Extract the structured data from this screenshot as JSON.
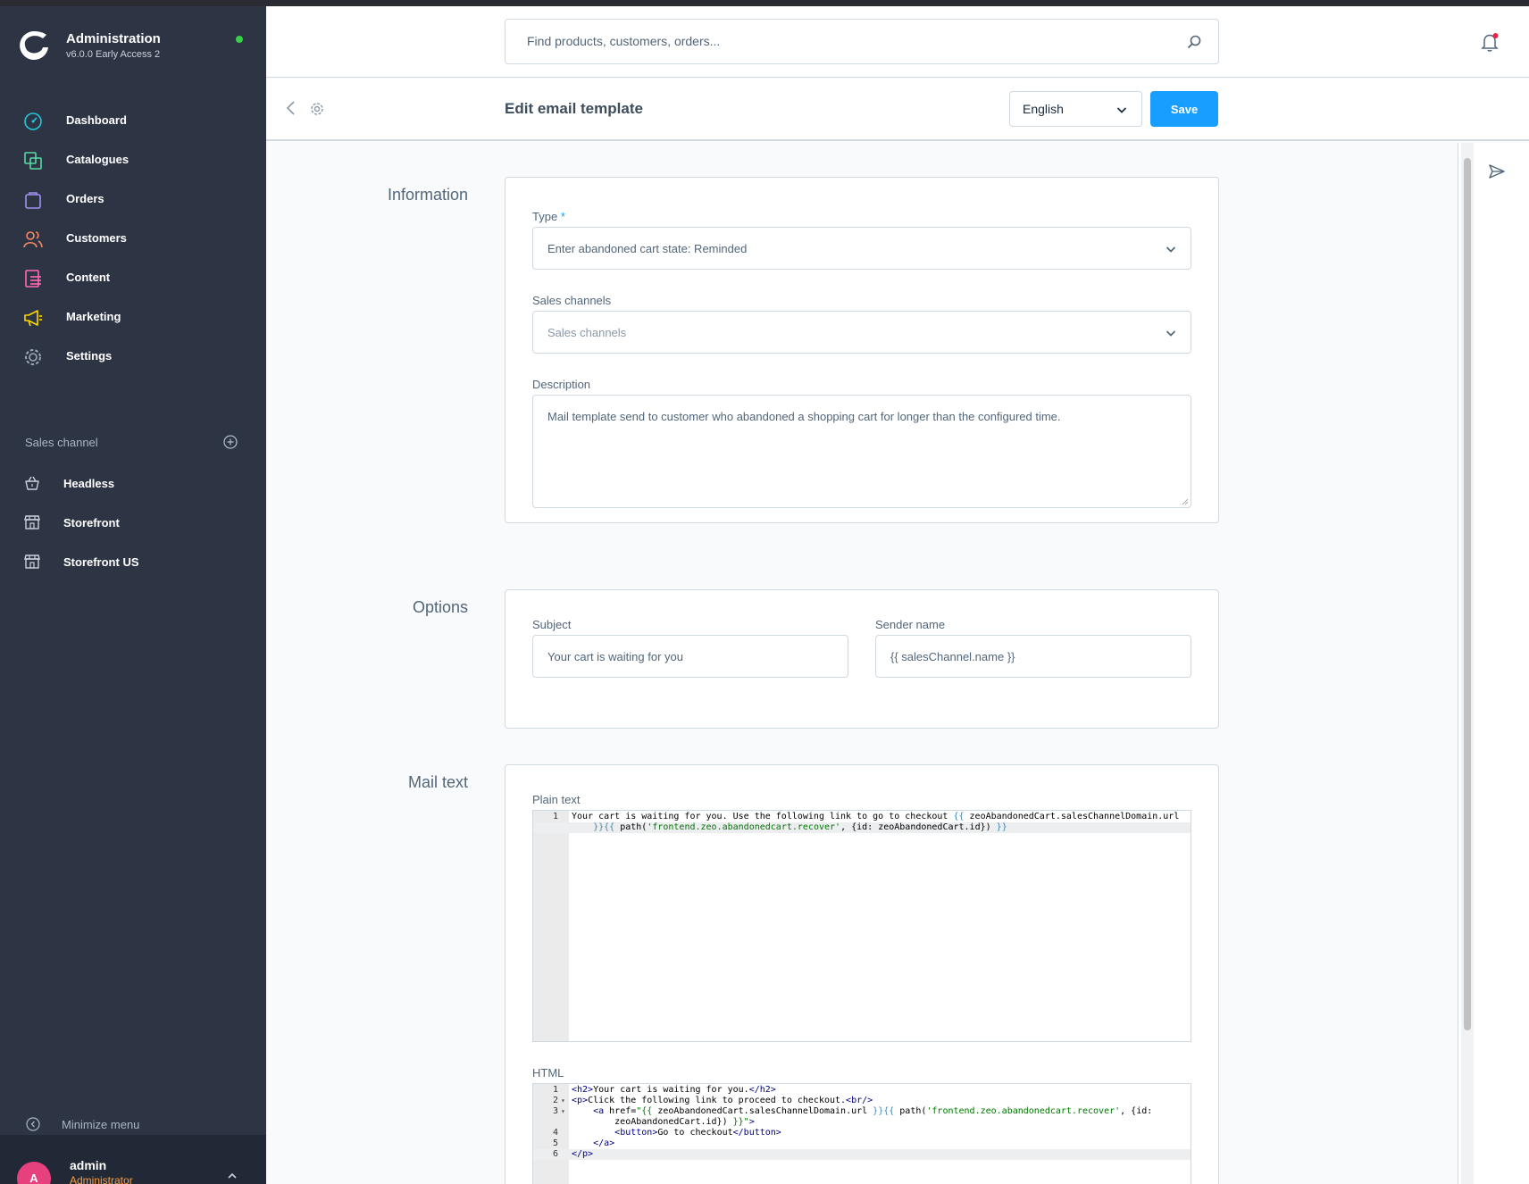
{
  "app": {
    "title": "Administration",
    "version": "v6.0.0 Early Access 2",
    "status_color": "#37d046",
    "accent_color": "#189eff"
  },
  "sidebar": {
    "items": [
      {
        "label": "Dashboard",
        "icon": "dashboard-icon"
      },
      {
        "label": "Catalogues",
        "icon": "catalogues-icon"
      },
      {
        "label": "Orders",
        "icon": "orders-icon"
      },
      {
        "label": "Customers",
        "icon": "customers-icon"
      },
      {
        "label": "Content",
        "icon": "content-icon"
      },
      {
        "label": "Marketing",
        "icon": "marketing-icon"
      },
      {
        "label": "Settings",
        "icon": "settings-icon"
      }
    ],
    "sales_channel_label": "Sales channel",
    "channels": [
      {
        "label": "Headless",
        "icon": "basket-icon"
      },
      {
        "label": "Storefront",
        "icon": "storefront-icon"
      },
      {
        "label": "Storefront US",
        "icon": "storefront-icon"
      }
    ],
    "minimize_label": "Minimize menu",
    "user": {
      "initial": "A",
      "name": "admin",
      "role": "Administrator"
    }
  },
  "header": {
    "search_placeholder": "Find products, customers, orders..."
  },
  "smartbar": {
    "title": "Edit email template",
    "language": "English",
    "save_label": "Save"
  },
  "information": {
    "section_title": "Information",
    "type_label": "Type",
    "required_mark": "*",
    "type_value": "Enter abandoned cart state: Reminded",
    "sales_channels_label": "Sales channels",
    "sales_channels_placeholder": "Sales channels",
    "description_label": "Description",
    "description_value": "Mail template send to customer who abandoned a shopping cart for longer than the configured time."
  },
  "options": {
    "section_title": "Options",
    "subject_label": "Subject",
    "subject_value": "Your cart is waiting for you",
    "sender_label": "Sender name",
    "sender_value": "{{ salesChannel.name }}"
  },
  "mail_text": {
    "section_title": "Mail text",
    "plain_label": "Plain text",
    "plain_lines": [
      {
        "num": "1",
        "parts": [
          {
            "t": "Your cart is waiting for you. Use the following link to go to checkout ",
            "c": ""
          },
          {
            "t": "{{",
            "c": "tw"
          },
          {
            "t": " zeoAbandonedCart.salesChannelDomain.url",
            "c": ""
          }
        ]
      },
      {
        "num": "",
        "parts": [
          {
            "t": "    ",
            "c": ""
          },
          {
            "t": "}}{{",
            "c": "tw"
          },
          {
            "t": " path(",
            "c": ""
          },
          {
            "t": "'frontend.zeo.abandonedcart.recover'",
            "c": "str"
          },
          {
            "t": ", {id: zeoAbandonedCart.id}) ",
            "c": ""
          },
          {
            "t": "}}",
            "c": "tw"
          }
        ]
      }
    ],
    "html_label": "HTML",
    "html_lines": [
      {
        "num": "1",
        "fold": "",
        "parts": [
          {
            "t": "<h2>",
            "c": "tag"
          },
          {
            "t": "Your cart is waiting for you.",
            "c": ""
          },
          {
            "t": "</h2>",
            "c": "tag"
          }
        ]
      },
      {
        "num": "2",
        "fold": "▾",
        "parts": [
          {
            "t": "<p>",
            "c": "tag"
          },
          {
            "t": "Click the following link to proceed to checkout.",
            "c": ""
          },
          {
            "t": "<br/>",
            "c": "tag"
          }
        ]
      },
      {
        "num": "3",
        "fold": "▾",
        "parts": [
          {
            "t": "    ",
            "c": ""
          },
          {
            "t": "<a ",
            "c": "tag"
          },
          {
            "t": "href=",
            "c": ""
          },
          {
            "t": "\"{{",
            "c": "str"
          },
          {
            "t": " zeoAbandonedCart.salesChannelDomain.url ",
            "c": ""
          },
          {
            "t": "}}{{",
            "c": "tw"
          },
          {
            "t": " path(",
            "c": ""
          },
          {
            "t": "'frontend.zeo.abandonedcart.recover'",
            "c": "str"
          },
          {
            "t": ", {id:",
            "c": ""
          }
        ]
      },
      {
        "num": "",
        "fold": "",
        "parts": [
          {
            "t": "        zeoAbandonedCart.id}) ",
            "c": ""
          },
          {
            "t": "}}\"",
            "c": "str"
          },
          {
            "t": ">",
            "c": "tag"
          }
        ]
      },
      {
        "num": "4",
        "fold": "",
        "parts": [
          {
            "t": "        ",
            "c": ""
          },
          {
            "t": "<button>",
            "c": "tag"
          },
          {
            "t": "Go to checkout",
            "c": ""
          },
          {
            "t": "</button>",
            "c": "tag"
          }
        ]
      },
      {
        "num": "5",
        "fold": "",
        "parts": [
          {
            "t": "    ",
            "c": ""
          },
          {
            "t": "</a>",
            "c": "tag"
          }
        ]
      },
      {
        "num": "6",
        "fold": "",
        "parts": [
          {
            "t": "</p>",
            "c": "tag"
          }
        ]
      }
    ]
  }
}
